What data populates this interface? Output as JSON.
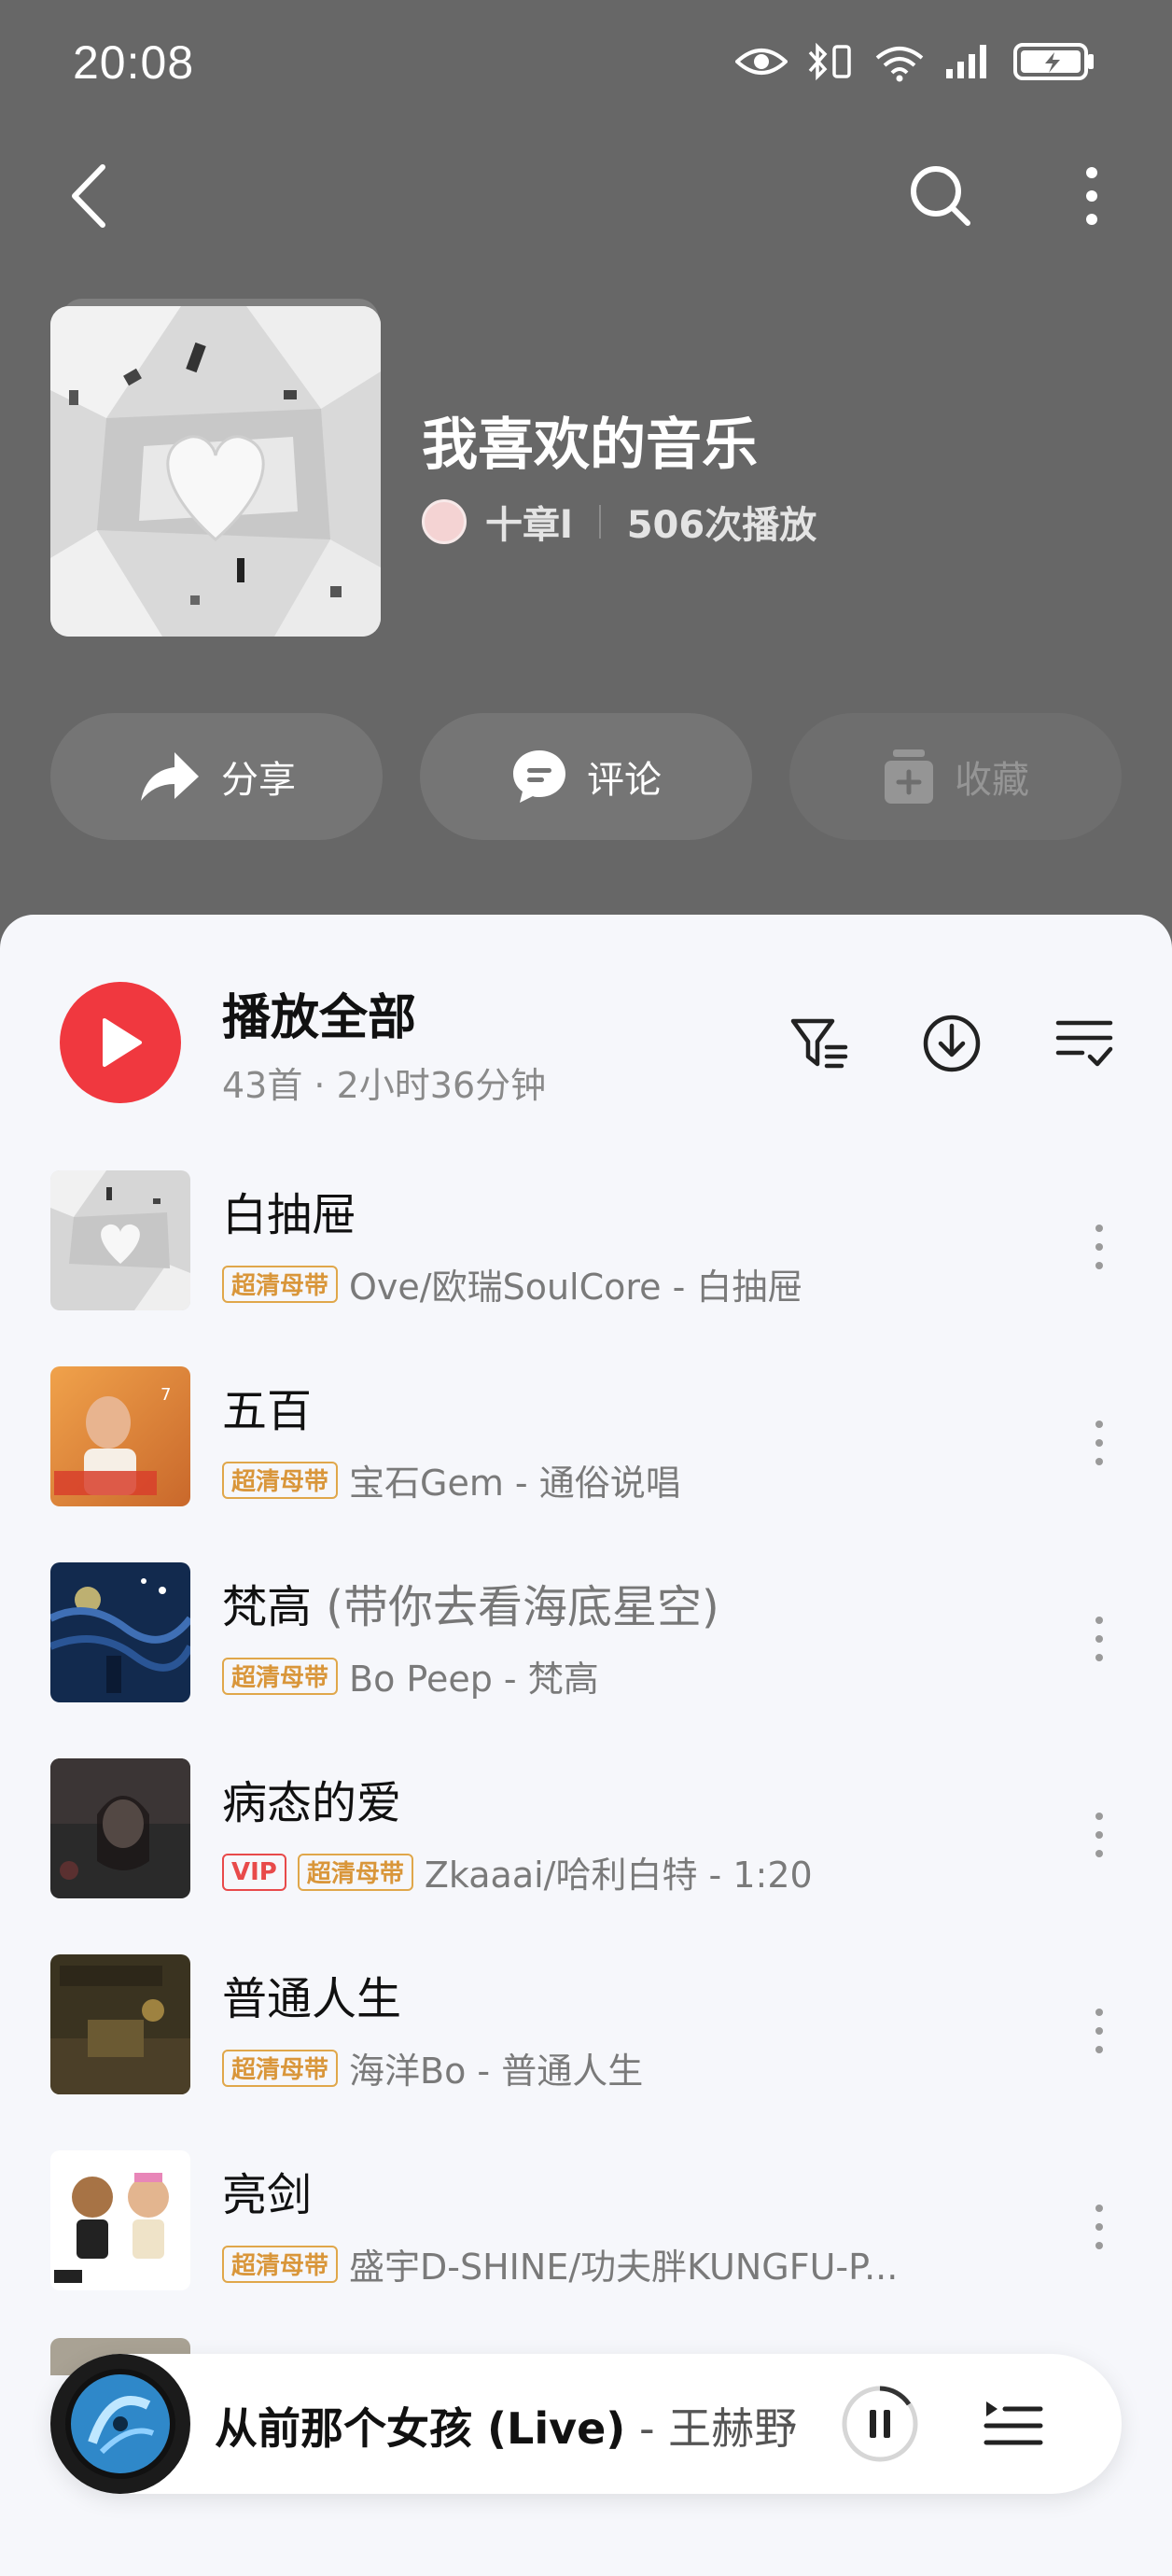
{
  "status_bar": {
    "time": "20:08"
  },
  "playlist": {
    "title": "我喜欢的音乐",
    "owner": "十章l",
    "plays": "506次播放"
  },
  "actions": [
    {
      "label": "分享",
      "icon": "share-icon"
    },
    {
      "label": "评论",
      "icon": "comment-icon"
    },
    {
      "label": "收藏",
      "icon": "collect-icon"
    }
  ],
  "play_all": {
    "label": "播放全部",
    "summary": "43首 · 2小时36分钟"
  },
  "songs": [
    {
      "title": "白抽屉",
      "title_suffix": "",
      "tags": [
        "超清母带"
      ],
      "subtitle": "Ove/欧瑞SoulCore - 白抽屉"
    },
    {
      "title": "五百",
      "title_suffix": "",
      "tags": [
        "超清母带"
      ],
      "subtitle": "宝石Gem - 通俗说唱"
    },
    {
      "title": "梵高",
      "title_suffix": " (带你去看海底星空)",
      "tags": [
        "超清母带"
      ],
      "subtitle": "Bo Peep - 梵高"
    },
    {
      "title": "病态的爱",
      "title_suffix": "",
      "tags": [
        "VIP",
        "超清母带"
      ],
      "subtitle": "Zkaaai/哈利白特 - 1:20"
    },
    {
      "title": "普通人生",
      "title_suffix": "",
      "tags": [
        "超清母带"
      ],
      "subtitle": "海洋Bo - 普通人生"
    },
    {
      "title": "亮剑",
      "title_suffix": "",
      "tags": [
        "超清母带"
      ],
      "subtitle": "盛宇D-SHINE/功夫胖KUNGFU-P..."
    }
  ],
  "now_playing": {
    "title": "从前那个女孩 (Live)",
    "artist": " - 王赫野"
  },
  "colors": {
    "accent": "#f0383f",
    "header_bg": "#676767",
    "tag": "#d9963a",
    "vip": "#e84a4a"
  }
}
